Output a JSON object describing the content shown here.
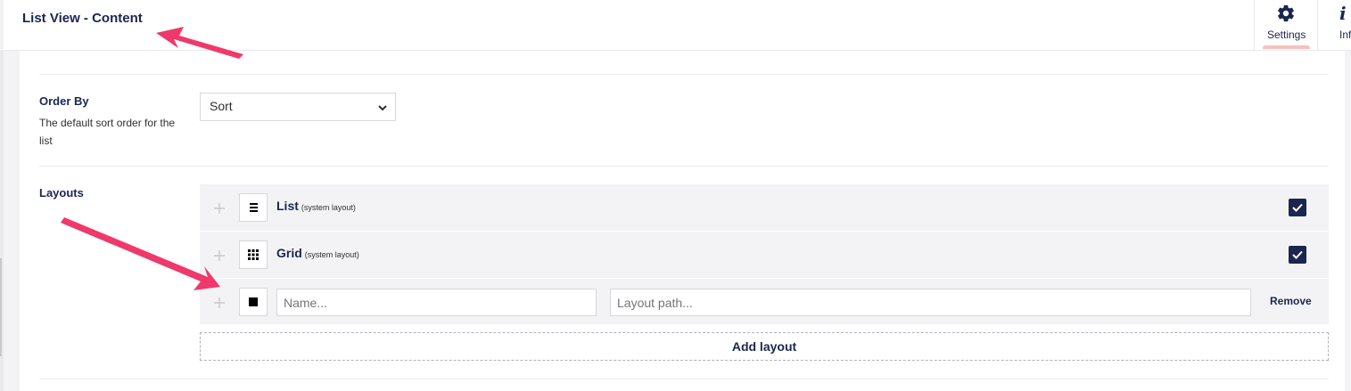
{
  "header": {
    "title": "List View - Content",
    "apps": [
      {
        "label": "Settings",
        "icon": "gear-icon",
        "active": true
      },
      {
        "label": "Inf",
        "icon": "info-icon",
        "active": false
      }
    ]
  },
  "order_by": {
    "label": "Order By",
    "description": "The default sort order for the list",
    "selected": "Sort"
  },
  "layouts": {
    "label": "Layouts",
    "items": [
      {
        "name": "List",
        "tag": "(system layout)",
        "icon": "list-icon",
        "checked": true
      },
      {
        "name": "Grid",
        "tag": "(system layout)",
        "icon": "grid-icon",
        "checked": true
      }
    ],
    "new_item": {
      "icon": "square-icon",
      "name_placeholder": "Name...",
      "path_placeholder": "Layout path...",
      "remove_label": "Remove"
    },
    "add_label": "Add layout"
  },
  "colors": {
    "primary": "#1b264f",
    "annotation_arrow": "#f0386b",
    "active_tab_indicator": "#f5c1bc"
  }
}
